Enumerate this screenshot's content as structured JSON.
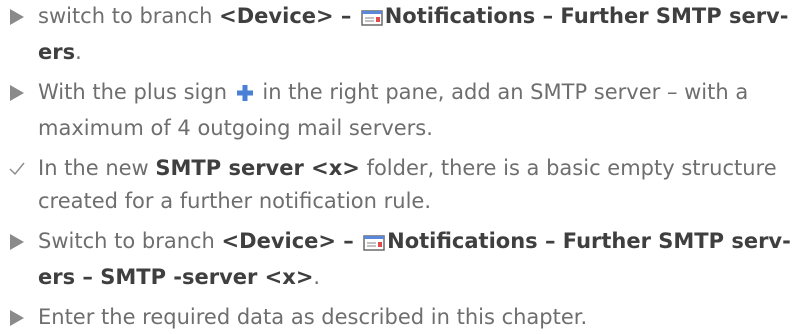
{
  "steps": [
    {
      "type": "action",
      "parts": {
        "t1": "switch to branch ",
        "b1": "<Device> – ",
        "b2": "Notifications – Further SMTP serv-",
        "b3": "ers",
        "t2": "."
      }
    },
    {
      "type": "action",
      "parts": {
        "t1": "With the plus sign ",
        "t2": " in the right pane, add an SMTP server – with a",
        "t3": "maximum of 4 outgoing mail servers."
      }
    },
    {
      "type": "result",
      "parts": {
        "t1": "In the new ",
        "b1": "SMTP server <x>",
        "t2": " folder, there is a basic empty structure",
        "t3": "created for a further notification rule."
      }
    },
    {
      "type": "action",
      "parts": {
        "t1": "Switch to branch ",
        "b1": "<Device> – ",
        "b2": "Notifications – Further SMTP serv-",
        "b3": "ers – SMTP -server <x>",
        "t2": "."
      }
    },
    {
      "type": "action",
      "parts": {
        "t1": "Enter the required data as described in this chapter."
      }
    }
  ],
  "icons": {
    "action_marker": "triangle-bullet-icon",
    "result_marker": "checkmark-icon",
    "notification": "envelope-notification-icon",
    "add": "plus-icon"
  },
  "colors": {
    "text": "#6e6e6e",
    "bold": "#3f3f3f",
    "marker": "#8a8a8a",
    "plus_icon": "#4a7fd6"
  }
}
